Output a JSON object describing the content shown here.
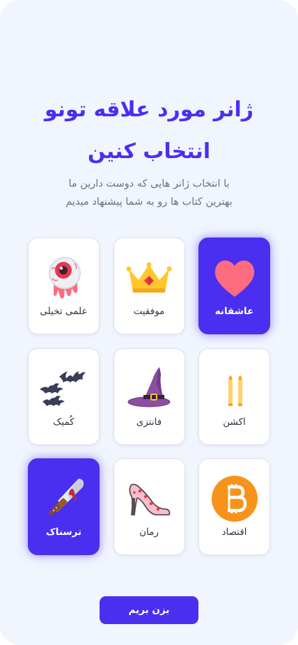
{
  "header": {
    "title_line1": "ژانر مورد علاقه تونو",
    "title_line2": "انتخاب کنین",
    "subtitle_line1": "با انتخاب ژانر هایی که دوست دارین ما",
    "subtitle_line2": "بهترین کتاب ها رو به شما پیشنهاد میدیم"
  },
  "genres": [
    {
      "label": "عاشقانه",
      "icon": "heart-icon",
      "selected": true
    },
    {
      "label": "موفقیت",
      "icon": "crown-icon",
      "selected": false
    },
    {
      "label": "علمی تخیلی",
      "icon": "alien-eyeball-icon",
      "selected": false
    },
    {
      "label": "اکشن",
      "icon": "bullets-icon",
      "selected": false
    },
    {
      "label": "فانتزی",
      "icon": "witch-hat-icon",
      "selected": false
    },
    {
      "label": "کُمیک",
      "icon": "bats-icon",
      "selected": false
    },
    {
      "label": "اقتصاد",
      "icon": "bitcoin-icon",
      "selected": false
    },
    {
      "label": "رمان",
      "icon": "high-heel-icon",
      "selected": false
    },
    {
      "label": "ترسناک",
      "icon": "bloody-knife-icon",
      "selected": true
    }
  ],
  "cta": {
    "label": "بزن بریم"
  },
  "colors": {
    "accent": "#4a2ff0",
    "background": "#f1f5fe",
    "card": "#ffffff"
  }
}
